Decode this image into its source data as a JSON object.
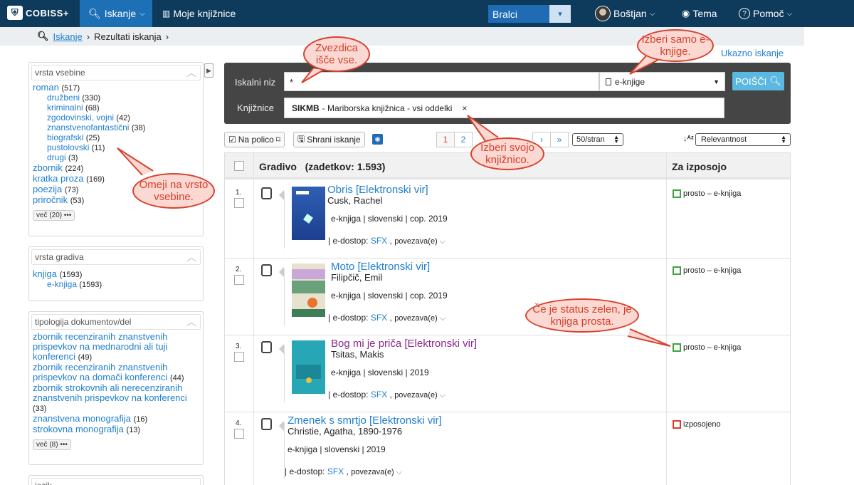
{
  "nav": {
    "logo": "COBISS+",
    "search_tab": "Iskanje",
    "my_libraries": "Moje knjižnice",
    "role_select": "Bralci",
    "user_name": "Boštjan",
    "theme": "Tema",
    "help": "Pomoč"
  },
  "breadcrumb": {
    "home": "Iskanje",
    "current": "Rezultati iskanja"
  },
  "facets": {
    "content_type": {
      "title": "vrsta vsebine",
      "items": [
        {
          "label": "roman",
          "count": "(517)",
          "sub": false
        },
        {
          "label": "družbeni",
          "count": "(330)",
          "sub": true
        },
        {
          "label": "kriminalni",
          "count": "(68)",
          "sub": true
        },
        {
          "label": "zgodovinski, vojni",
          "count": "(42)",
          "sub": true
        },
        {
          "label": "znanstvenofantastični",
          "count": "(38)",
          "sub": true
        },
        {
          "label": "biografski",
          "count": "(25)",
          "sub": true
        },
        {
          "label": "pustolovski",
          "count": "(11)",
          "sub": true
        },
        {
          "label": "drugi",
          "count": "(3)",
          "sub": true
        },
        {
          "label": "zbornik",
          "count": "(224)",
          "sub": false
        },
        {
          "label": "kratka proza",
          "count": "(169)",
          "sub": false
        },
        {
          "label": "poezija",
          "count": "(73)",
          "sub": false
        },
        {
          "label": "priročnik",
          "count": "(53)",
          "sub": false
        }
      ],
      "more": "več (20) •••"
    },
    "material_type": {
      "title": "vrsta gradiva",
      "items": [
        {
          "label": "knjiga",
          "count": "(1593)",
          "sub": false
        },
        {
          "label": "e-knjiga",
          "count": "(1593)",
          "sub": true
        }
      ]
    },
    "doc_typology": {
      "title": "tipologija dokumentov/del",
      "items": [
        {
          "label": "zbornik recenziranih znanstvenih prispevkov na mednarodni ali tuji konferenci",
          "count": "(49)"
        },
        {
          "label": "zbornik recenziranih znanstvenih prispevkov na domači konferenci",
          "count": "(44)"
        },
        {
          "label": "zbornik strokovnih ali nerecenziranih znanstvenih prispevkov na konferenci",
          "count": "(33)"
        },
        {
          "label": "znanstvena monografija",
          "count": "(16)"
        },
        {
          "label": "strokovna monografija",
          "count": "(13)"
        }
      ],
      "more": "več (8) •••"
    },
    "language": {
      "title": "jezik"
    }
  },
  "search": {
    "advanced_link": "Ukazno iskanje",
    "query_label": "Iskalni niz",
    "query_value": "*",
    "type_select": "e-knjige",
    "search_button": "POIŠČI",
    "library_label": "Knjižnice",
    "library_code": "SIKMB",
    "library_name": "- Mariborska knjižnica - vsi oddelki",
    "library_remove": "×"
  },
  "toolbar": {
    "shelf": "Na polico",
    "save_search": "Shrani iskanje",
    "pages": [
      "1",
      "2",
      "›",
      "»"
    ],
    "per_page": "50/stran",
    "sort": "Relevantnost"
  },
  "results": {
    "header_title": "Gradivo",
    "header_count": "(zadetkov: 1.593)",
    "header_availability": "Za izposojo",
    "rows": [
      {
        "num": "1.",
        "title": "Obris [Elektronski vir]",
        "author": "Cusk, Rachel",
        "meta": "e-knjiga | slovenski | cop. 2019",
        "access_prefix": "| e-dostop: ",
        "access_link": "SFX",
        "access_more": "povezava(e)",
        "status": "prosto – e-knjiga",
        "status_color": "#3aa53a",
        "visited": false,
        "has_cover": true
      },
      {
        "num": "2.",
        "title": "Moto [Elektronski vir]",
        "author": "Filipčič, Emil",
        "meta": "e-knjiga | slovenski | cop. 2019",
        "access_prefix": "| e-dostop: ",
        "access_link": "SFX",
        "access_more": "povezava(e)",
        "status": "prosto – e-knjiga",
        "status_color": "#3aa53a",
        "visited": false,
        "has_cover": true
      },
      {
        "num": "3.",
        "title": "Bog mi je priča [Elektronski vir]",
        "author": "Tsitas, Makis",
        "meta": "e-knjiga | slovenski | 2019",
        "access_prefix": "| e-dostop: ",
        "access_link": "SFX",
        "access_more": "povezava(e)",
        "status": "prosto – e-knjiga",
        "status_color": "#3aa53a",
        "visited": true,
        "has_cover": true
      },
      {
        "num": "4.",
        "title": "Zmenek s smrtjo [Elektronski vir]",
        "author": "Christie, Agatha, 1890-1976",
        "meta": "e-knjiga | slovenski | 2019",
        "access_prefix": "| e-dostop: ",
        "access_link": "SFX",
        "access_more": "povezava(e)",
        "status": "izposojeno",
        "status_color": "#e03a2a",
        "visited": false,
        "has_cover": false
      }
    ]
  },
  "callouts": {
    "star": "Zvezdica išče vse.",
    "ebooks": "Izberi samo e-knjige.",
    "library": "Izberi svojo knjižnico.",
    "content": "Omeji na vrsto vsebine.",
    "status": "Če je status zelen, je knjiga prosta."
  }
}
